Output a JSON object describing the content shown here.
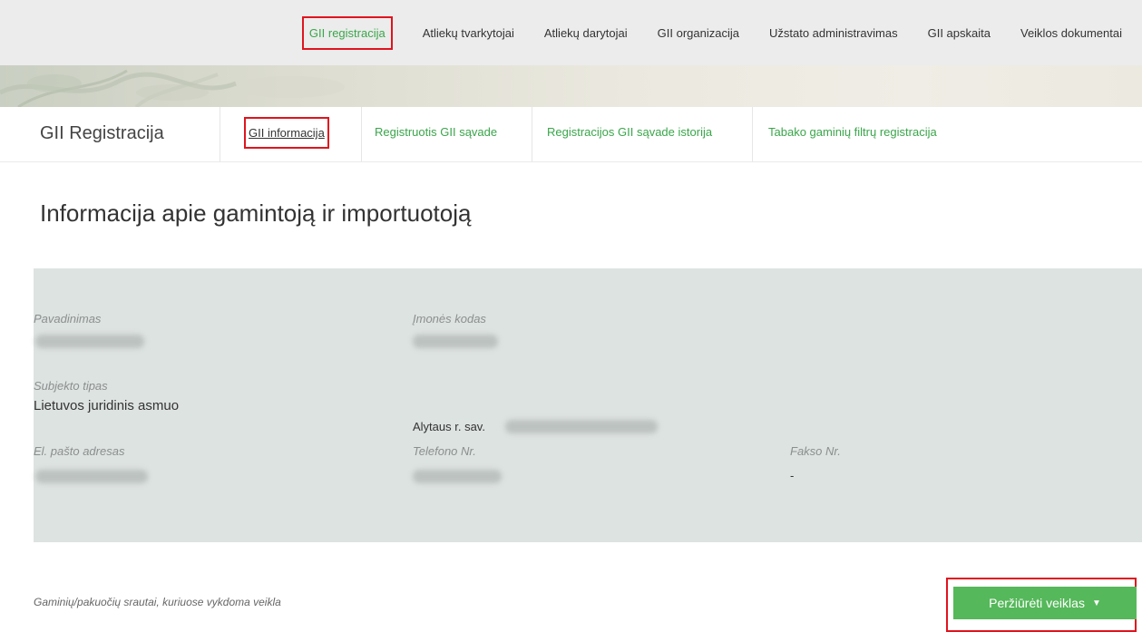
{
  "top_nav": {
    "items": [
      {
        "label": "GII registracija",
        "active": true
      },
      {
        "label": "Atliekų tvarkytojai"
      },
      {
        "label": "Atliekų darytojai"
      },
      {
        "label": "GII organizacija"
      },
      {
        "label": "Užstato administravimas"
      },
      {
        "label": "GII apskaita"
      },
      {
        "label": "Veiklos dokumentai"
      }
    ]
  },
  "sub_nav": {
    "title": "GII Registracija",
    "tabs": [
      {
        "label": "GII informacija",
        "current": true
      },
      {
        "label": "Registruotis GII sąvade"
      },
      {
        "label": "Registracijos GII sąvade istorija"
      },
      {
        "label": "Tabako gaminių filtrų registracija"
      }
    ]
  },
  "page_title": "Informacija apie gamintoją ir importuotoją",
  "details": {
    "name_label": "Pavadinimas",
    "company_code_label": "Įmonės kodas",
    "subject_type_label": "Subjekto tipas",
    "subject_type_value": "Lietuvos juridinis asmuo",
    "address_municipality": "Alytaus r. sav.",
    "email_label": "El. pašto adresas",
    "phone_label": "Telefono Nr.",
    "fax_label": "Fakso Nr.",
    "fax_value": "-"
  },
  "flows_note": "Gaminių/pakuočių srautai, kuriuose vykdoma veikla",
  "view_activities_button": "Peržiūrėti veiklas",
  "colors": {
    "accent_green": "#3aa64a",
    "button_green": "#55b85a",
    "highlight_red": "#e0141e",
    "panel_bg": "#dde3e1"
  }
}
